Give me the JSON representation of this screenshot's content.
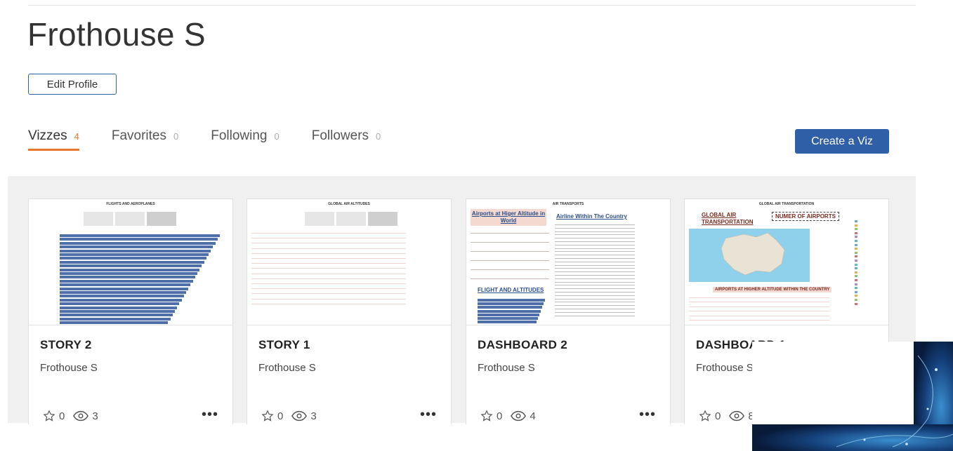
{
  "profile": {
    "name": "Frothouse S",
    "edit_label": "Edit Profile"
  },
  "tabs": [
    {
      "label": "Vizzes",
      "count": "4"
    },
    {
      "label": "Favorites",
      "count": "0"
    },
    {
      "label": "Following",
      "count": "0"
    },
    {
      "label": "Followers",
      "count": "0"
    }
  ],
  "create_label": "Create a Viz",
  "cards": [
    {
      "title": "STORY 2",
      "author": "Frothouse S",
      "favorites": "0",
      "views": "3",
      "thumb_title": "FLIGHTS AND AEROPLANES",
      "icons": [
        "star-icon",
        "eye-icon",
        "more-icon"
      ]
    },
    {
      "title": "STORY 1",
      "author": "Frothouse S",
      "favorites": "0",
      "views": "3",
      "thumb_title": "GLOBAL AIR ALTITUDES"
    },
    {
      "title": "DASHBOARD 2",
      "author": "Frothouse S",
      "favorites": "0",
      "views": "4",
      "thumb_title": "AIR TRANSPORTS",
      "thumb_headings": [
        "Airports at Higer Altitude in World",
        "Airline Within The Country",
        "FLIGHT AND ALTITUDES"
      ]
    },
    {
      "title": "DASHBOARD 1",
      "author": "Frothouse S",
      "favorites": "0",
      "views": "8",
      "thumb_title": "GLOBAL AIR TRANSPORTATION",
      "thumb_headings": [
        "GLOBAL AIR TRANSPORTATION",
        "NUMER OF AIRPORTS",
        "AIRPORTS AT HIGHER ALTITUDE WITHIN THE COUNTRY"
      ]
    }
  ],
  "colors": {
    "accent": "#e8762c",
    "primary": "#2f5fa6",
    "bar": "#4e6fa8"
  }
}
